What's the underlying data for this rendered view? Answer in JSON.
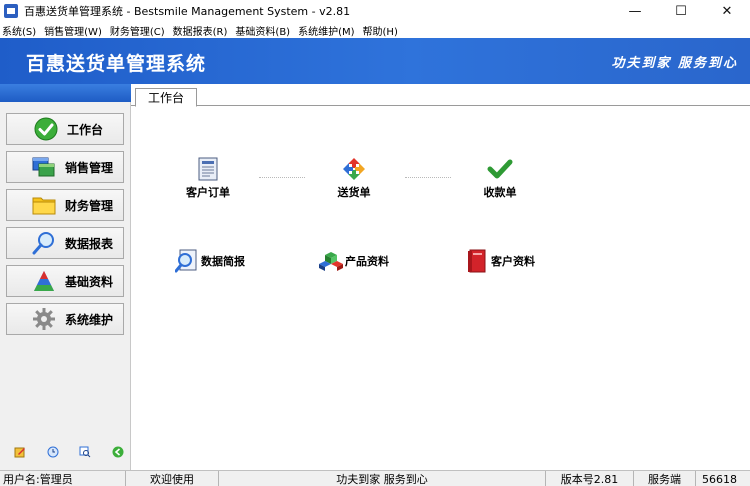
{
  "window": {
    "title": "百惠送货单管理系统 - Bestsmile Management System - v2.81",
    "controls": {
      "minimize": "—",
      "maximize": "☐",
      "close": "✕"
    }
  },
  "menu": [
    "系统(S)",
    "销售管理(W)",
    "财务管理(C)",
    "数据报表(R)",
    "基础资料(B)",
    "系统维护(M)",
    "帮助(H)"
  ],
  "banner": {
    "title": "百惠送货单管理系统",
    "slogan": "功夫到家 服务到心"
  },
  "nav": [
    {
      "label": "工作台",
      "icon": "check-circle-icon"
    },
    {
      "label": "销售管理",
      "icon": "windows-icon"
    },
    {
      "label": "财务管理",
      "icon": "folder-icon"
    },
    {
      "label": "数据报表",
      "icon": "magnifier-icon"
    },
    {
      "label": "基础资料",
      "icon": "pyramid-icon"
    },
    {
      "label": "系统维护",
      "icon": "gear-icon"
    }
  ],
  "tab": {
    "label": "工作台"
  },
  "workflow": [
    {
      "label": "客户订单",
      "icon": "order-sheet-icon"
    },
    {
      "label": "送货单",
      "icon": "refresh-arrows-icon"
    },
    {
      "label": "收款单",
      "icon": "checkmark-icon"
    }
  ],
  "shortcuts": [
    {
      "label": "数据简报",
      "icon": "report-magnifier-icon"
    },
    {
      "label": "产品资料",
      "icon": "cubes-icon"
    },
    {
      "label": "客户资料",
      "icon": "red-book-icon"
    }
  ],
  "status": {
    "user": "用户名:管理员",
    "welcome": "欢迎使用",
    "slogan": "功夫到家 服务到心",
    "version": "版本号2.81",
    "mode": "服务端",
    "code": "56618"
  },
  "colors": {
    "banner": "#2a6ad4",
    "nav_strip": "#2a6ad4"
  }
}
